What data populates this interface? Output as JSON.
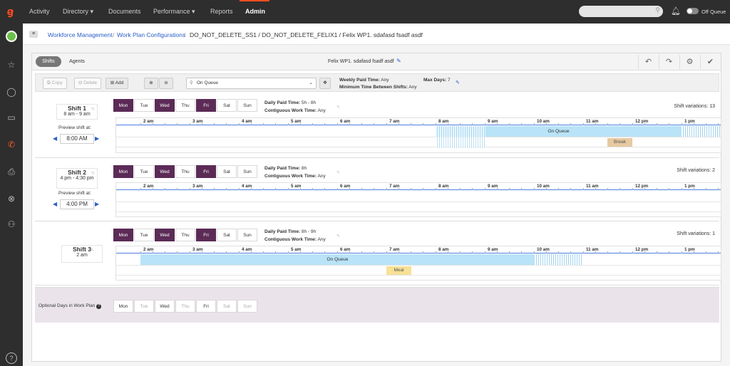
{
  "nav": {
    "items": [
      "Activity",
      "Directory",
      "Documents",
      "Performance",
      "Reports",
      "Admin"
    ],
    "status": "Off Queue"
  },
  "breadcrumb": {
    "items": [
      "Workforce Management",
      "Work Plan Configurations",
      "DO_NOT_DELETE_SS1 / DO_NOT_DELETE_FELIX1 / Felix WP1. sdafasd fsadf asdf"
    ],
    "sep": "/"
  },
  "tabs": {
    "shifts": "Shifts",
    "agents": "Agents"
  },
  "plan_title": "Felix WP1. sdafasd fsadf asdf",
  "toolbar": {
    "copy": "Copy",
    "delete": "Delete",
    "add": "Add",
    "activity": "On Queue",
    "weekly_paid_label": "Weekly Paid Time:",
    "weekly_paid_value": "Any",
    "min_between_label": "Minimum Time Between Shifts:",
    "min_between_value": "Any",
    "max_days_label": "Max Days:",
    "max_days_value": "7"
  },
  "days": [
    "Mon",
    "Tue",
    "Wed",
    "Thu",
    "Fri",
    "Sat",
    "Sun"
  ],
  "hours": [
    "2 am",
    "3 am",
    "4 am",
    "5 am",
    "6 am",
    "7 am",
    "8 am",
    "9 am",
    "10 am",
    "11 am",
    "12 pm",
    "1 pm"
  ],
  "labels": {
    "daily_paid": "Daily Paid Time:",
    "contiguous": "Contiguous Work Time:",
    "preview": "Preview shift at:",
    "optional": "Optional Days in Work Plan"
  },
  "shifts": [
    {
      "name": "Shift 1",
      "window": "8 am - 9 am",
      "preview": "8:00 AM",
      "daily": "5h - 8h",
      "contiguous": "Any",
      "variations": "Shift variations: 13",
      "activity": "On Queue",
      "break": "Break"
    },
    {
      "name": "Shift 2",
      "window": "4 pm - 4:30 pm",
      "preview": "4:00 PM",
      "daily": "8h",
      "contiguous": "Any",
      "variations": "Shift variations: 2"
    },
    {
      "name": "Shift 3",
      "window": "2 am",
      "daily": "8h - 9h",
      "contiguous": "Any",
      "variations": "Shift variations: 1",
      "activity": "On Queue",
      "meal": "Meal"
    }
  ]
}
